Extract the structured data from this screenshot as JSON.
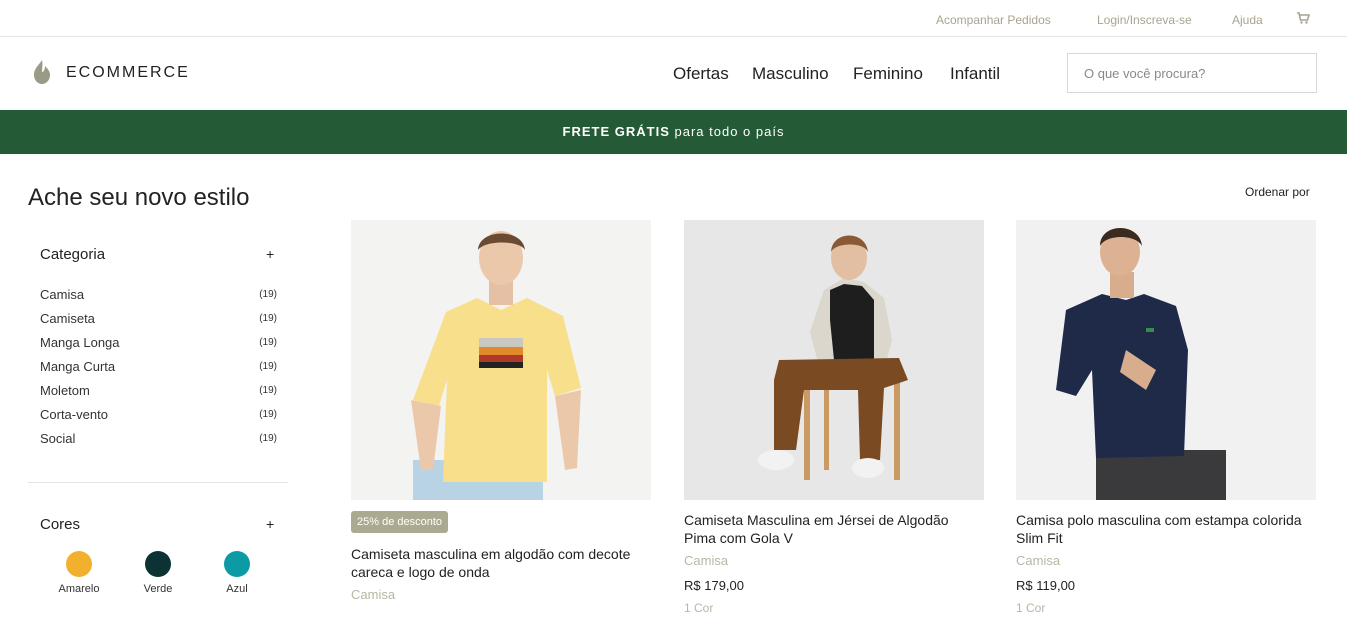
{
  "utility": {
    "track_orders": "Acompanhar Pedidos",
    "login": "Login/Inscreva-se",
    "help": "Ajuda"
  },
  "header": {
    "brand": "ECOMMERCE",
    "nav": [
      "Ofertas",
      "Masculino",
      "Feminino",
      "Infantil"
    ],
    "search_placeholder": "O que você procura?"
  },
  "promo": {
    "bold": "FRETE GRÁTIS",
    "rest": " para todo o país",
    "color": "#245a36"
  },
  "page": {
    "title": "Ache seu novo estilo",
    "sort_label": "Ordenar por"
  },
  "filters": {
    "category": {
      "title": "Categoria",
      "toggle": "+",
      "items": [
        {
          "label": "Camisa",
          "count": "(19)"
        },
        {
          "label": "Camiseta",
          "count": "(19)"
        },
        {
          "label": "Manga Longa",
          "count": "(19)"
        },
        {
          "label": "Manga Curta",
          "count": "(19)"
        },
        {
          "label": "Moletom",
          "count": "(19)"
        },
        {
          "label": "Corta-vento",
          "count": "(19)"
        },
        {
          "label": "Social",
          "count": "(19)"
        }
      ]
    },
    "colors": {
      "title": "Cores",
      "toggle": "+",
      "items": [
        {
          "label": "Amarelo",
          "color": "#f1b12e"
        },
        {
          "label": "Verde",
          "color": "#0d3234"
        },
        {
          "label": "Azul",
          "color": "#0c9aa4"
        }
      ]
    }
  },
  "products": [
    {
      "badge": "25% de desconto",
      "name": "Camiseta masculina em algodão com decote careca e logo de onda",
      "type": "Camisa",
      "price": "",
      "colors": ""
    },
    {
      "badge": "",
      "name": "Camiseta Masculina em Jérsei de Algodão Pima com Gola V",
      "type": "Camisa",
      "price": "R$ 179,00",
      "colors": "1 Cor"
    },
    {
      "badge": "",
      "name": "Camisa polo masculina com estampa colorida Slim Fit",
      "type": "Camisa",
      "price": "R$ 119,00",
      "colors": "1 Cor"
    }
  ]
}
